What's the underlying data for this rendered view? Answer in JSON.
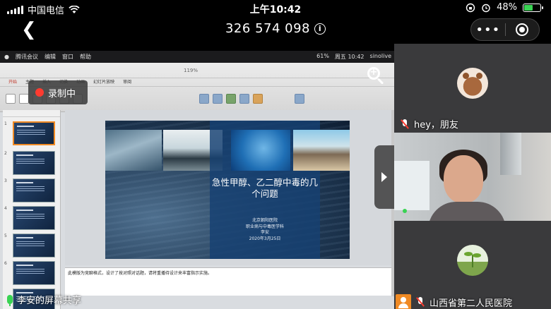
{
  "status_bar": {
    "carrier": "中国电信",
    "time": "上午10:42",
    "battery": "48%",
    "battery_level": 0.48
  },
  "meeting": {
    "id": "326 574 098",
    "more_label": "•••"
  },
  "shared_screen": {
    "mac_menu": [
      "腾讯会议",
      "编辑",
      "窗口",
      "帮助"
    ],
    "mac_status": [
      "61%",
      "周五 10:42",
      "sinolive"
    ],
    "recording_label": "录制中",
    "ribbon_tabs": [
      "开始",
      "主题",
      "插入",
      "切换",
      "动画",
      "幻灯片放映",
      "审阅"
    ],
    "zoom_value": "119%",
    "slide": {
      "title": "急性甲醇、乙二醇中毒的几个问题",
      "subtitle_lines": [
        "北京朝阳医院",
        "职业病与中毒医学科",
        "李安",
        "2020年3月25日"
      ]
    },
    "notes_text": "此模版为竞聊格式，设计了按对照对话题，请将重播待设计来丰富指示实施。",
    "sharer_label": "李安的屏幕共享"
  },
  "participants": [
    {
      "name": "hey，朋友",
      "avatar": "teddy-bear",
      "muted": true
    },
    {
      "name": "",
      "avatar": "video",
      "muted": false
    },
    {
      "name": "山西省第二人民医院",
      "avatar": "sprout",
      "muted": true
    }
  ],
  "colors": {
    "record_red": "#ff3b30",
    "battery_green": "#39d353",
    "slide_blue": "#164173",
    "thumbnail_active": "#f08a24"
  }
}
